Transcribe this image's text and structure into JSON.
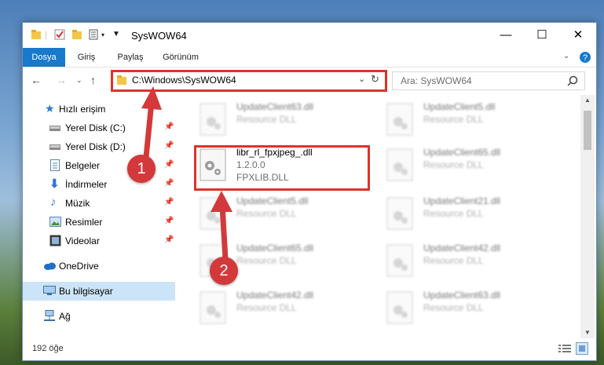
{
  "window": {
    "title": "SysWOW64"
  },
  "ribbon": {
    "tabs": [
      "Dosya",
      "Giriş",
      "Paylaş",
      "Görünüm"
    ]
  },
  "address": {
    "path": "C:\\Windows\\SysWOW64"
  },
  "search": {
    "placeholder": "Ara: SysWOW64"
  },
  "sidebar": {
    "items": [
      {
        "label": "Hızlı erişim"
      },
      {
        "label": "Yerel Disk (C:)"
      },
      {
        "label": "Yerel Disk (D:)"
      },
      {
        "label": "Belgeler"
      },
      {
        "label": "İndirmeler"
      },
      {
        "label": "Müzik"
      },
      {
        "label": "Resimler"
      },
      {
        "label": "Videolar"
      },
      {
        "label": "OneDrive"
      },
      {
        "label": "Bu bilgisayar"
      },
      {
        "label": "Ağ"
      }
    ]
  },
  "files": [
    {
      "name": "UpdateClient63.dll",
      "desc": "Resource DLL"
    },
    {
      "name": "UpdateClient5.dll",
      "desc": "Resource DLL"
    },
    {
      "name": "libr_rl_fpxjpeg_.dll",
      "version": "1.2.0.0",
      "desc": "FPXLIB.DLL"
    },
    {
      "name": "UpdateClient65.dll",
      "desc": "Resource DLL"
    },
    {
      "name": "UpdateClient5.dll",
      "desc": "Resource DLL"
    },
    {
      "name": "UpdateClient21.dll",
      "desc": "Resource DLL"
    },
    {
      "name": "UpdateClient65.dll",
      "desc": "Resource DLL"
    },
    {
      "name": "UpdateClient42.dll",
      "desc": "Resource DLL"
    },
    {
      "name": "UpdateClient42.dll",
      "desc": "Resource DLL"
    },
    {
      "name": "UpdateClient63.dll",
      "desc": "Resource DLL"
    }
  ],
  "status": {
    "count": "192 öğe"
  },
  "annotations": {
    "step1": "1",
    "step2": "2"
  },
  "colors": {
    "accent": "#1979ca",
    "highlight": "#e0312b",
    "badge": "#d3393a"
  }
}
